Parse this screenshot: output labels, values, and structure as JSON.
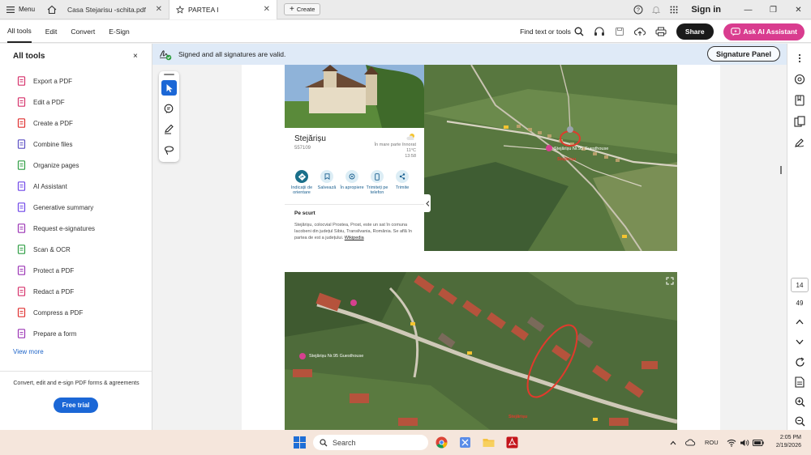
{
  "titlebar": {
    "menu_label": "Menu",
    "tabs": [
      {
        "label": "Casa Stejarisu -schita.pdf",
        "active": false
      },
      {
        "label": "PARTEA I",
        "active": true
      }
    ],
    "create_label": "Create",
    "signin_label": "Sign in",
    "window_controls": [
      "—",
      "❐",
      "✕"
    ]
  },
  "menubar": {
    "items": [
      "All tools",
      "Edit",
      "Convert",
      "E-Sign"
    ],
    "find_label": "Find text or tools",
    "share_label": "Share",
    "ai_label": "Ask AI Assistant"
  },
  "left_panel": {
    "title": "All tools",
    "close": "×",
    "tools": [
      {
        "label": "Export a PDF",
        "icon": "export-pdf-icon",
        "color": "#d6336c"
      },
      {
        "label": "Edit a PDF",
        "icon": "edit-pdf-icon",
        "color": "#d6336c"
      },
      {
        "label": "Create a PDF",
        "icon": "create-pdf-icon",
        "color": "#e03131"
      },
      {
        "label": "Combine files",
        "icon": "combine-files-icon",
        "color": "#5c4fc4"
      },
      {
        "label": "Organize pages",
        "icon": "organize-pages-icon",
        "color": "#2f9e44"
      },
      {
        "label": "AI Assistant",
        "icon": "ai-assistant-icon",
        "color": "#7048e8"
      },
      {
        "label": "Generative summary",
        "icon": "generative-summary-icon",
        "color": "#7048e8"
      },
      {
        "label": "Request e-signatures",
        "icon": "request-esignatures-icon",
        "color": "#9c36b5"
      },
      {
        "label": "Scan & OCR",
        "icon": "scan-ocr-icon",
        "color": "#2f9e44"
      },
      {
        "label": "Protect a PDF",
        "icon": "protect-pdf-icon",
        "color": "#9c36b5"
      },
      {
        "label": "Redact a PDF",
        "icon": "redact-pdf-icon",
        "color": "#d6336c"
      },
      {
        "label": "Compress a PDF",
        "icon": "compress-pdf-icon",
        "color": "#e03131"
      },
      {
        "label": "Prepare a form",
        "icon": "prepare-form-icon",
        "color": "#9c36b5"
      }
    ],
    "view_more": "View more",
    "promo": "Convert, edit and e-sign PDF forms & agreements",
    "free_trial": "Free trial"
  },
  "signature_banner": {
    "text": "Signed and all signatures are valid.",
    "panel_button": "Signature Panel"
  },
  "map_card": {
    "place_name": "Stejărișu",
    "postal_code": "557109",
    "weather_line1": "În mare parte înnorat",
    "weather_line2": "11°C",
    "weather_line3": "13:58",
    "actions": [
      {
        "label": "Indicații de orientare",
        "icon": "directions-icon"
      },
      {
        "label": "Salvează",
        "icon": "bookmark-icon"
      },
      {
        "label": "În apropiere",
        "icon": "nearby-icon"
      },
      {
        "label": "Trimiteți pe telefon",
        "icon": "send-to-phone-icon"
      },
      {
        "label": "Trimite",
        "icon": "share-icon"
      }
    ],
    "summary_heading": "Pe scurt",
    "summary_text": "Stejărișu, colocvial Prostea, Prost, este un sat în comuna Iacobeni din județul Sibiu, Transilvania, România. Se află în partea de est a județului.",
    "summary_link": "Wikipedia"
  },
  "map_labels": {
    "guesthouse_top": "Stejărișu Nr.95 Guesthouse",
    "village_top": "Stejărișu",
    "guesthouse_bottom": "Stejărișu Nr.95 Guesthouse",
    "village_bottom": "Stejărișu"
  },
  "page_nav": {
    "current": "14",
    "total": "49"
  },
  "taskbar": {
    "search_placeholder": "Search",
    "language": "ROU",
    "time": "2:05 PM",
    "date": "2/19/2026"
  },
  "colors": {
    "accent": "#1b67d6",
    "ai_button": "#d93c8f",
    "banner": "#dfeaf7",
    "marker_red": "#e13a2c"
  }
}
